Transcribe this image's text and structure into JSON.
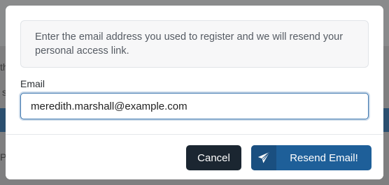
{
  "background": {
    "fragment_a": "th",
    "fragment_b": "s",
    "fragment_c": "P"
  },
  "modal": {
    "info_text": "Enter the email address you used to register and we will resend your personal access link.",
    "email_label": "Email",
    "email_value": "meredith.marshall@example.com",
    "cancel_label": "Cancel",
    "resend_label": "Resend Email!",
    "resend_icon": "paper-plane-icon"
  },
  "colors": {
    "primary": "#1e5f99",
    "dark": "#1b2631",
    "focus_border": "#3a74ad"
  }
}
